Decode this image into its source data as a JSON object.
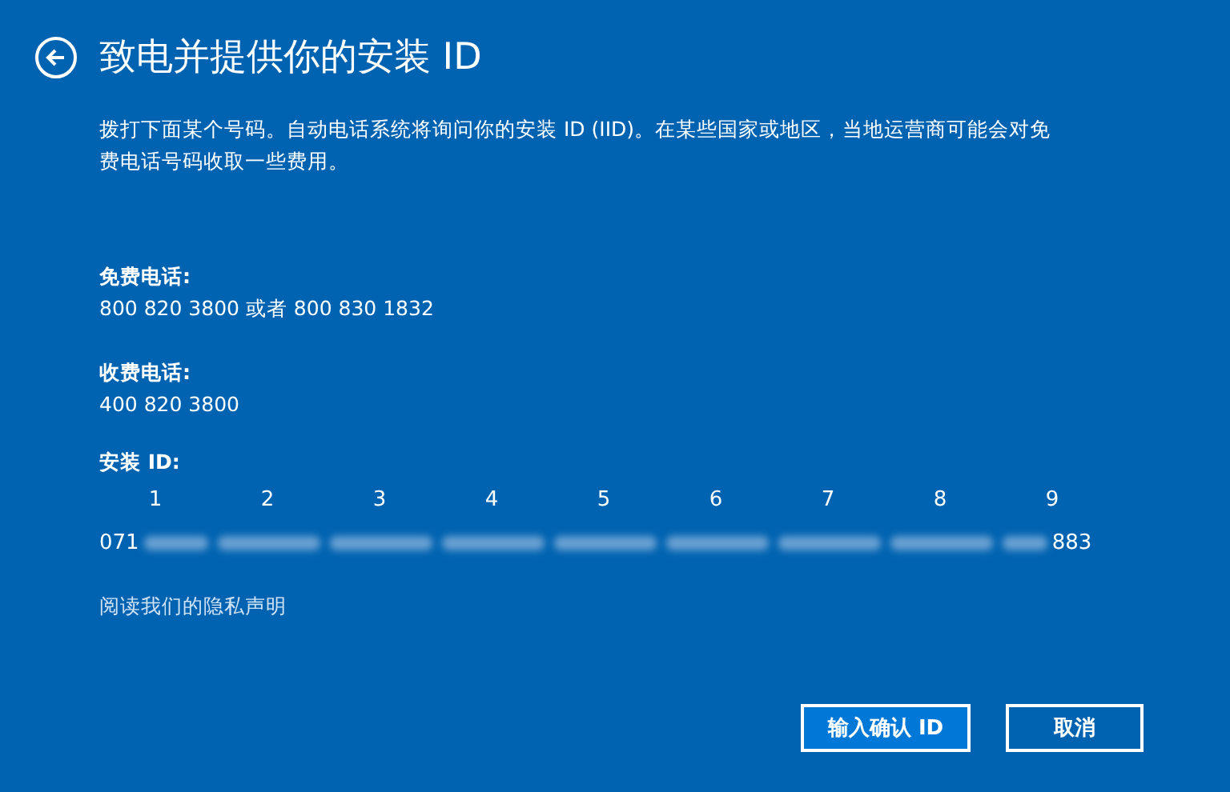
{
  "title": "致电并提供你的安装 ID",
  "intro": "拨打下面某个号码。自动电话系统将询问你的安装 ID (IID)。在某些国家或地区，当地运营商可能会对免费电话号码收取一些费用。",
  "phones": [
    {
      "label": "免费电话:",
      "value": "800 820 3800 或者 800 830 1832"
    },
    {
      "label": "收费电话:",
      "value": "400 820 3800"
    }
  ],
  "installation_id": {
    "label": "安装 ID:",
    "columns": [
      "1",
      "2",
      "3",
      "4",
      "5",
      "6",
      "7",
      "8",
      "9"
    ],
    "start": "071",
    "end": "883"
  },
  "privacy_link": "阅读我们的隐私声明",
  "buttons": [
    {
      "label": "输入确认 ID",
      "kind": "primary"
    },
    {
      "label": "取消",
      "kind": "secondary"
    }
  ]
}
